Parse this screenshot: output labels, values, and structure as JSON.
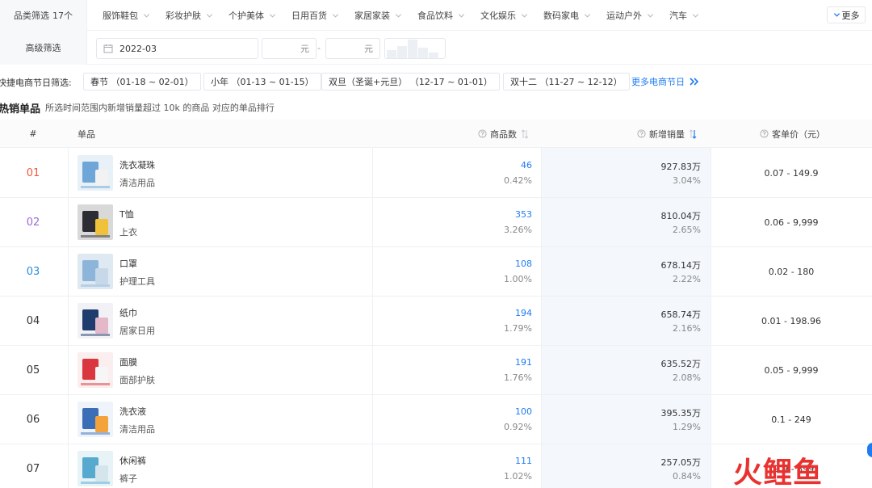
{
  "category_filter": {
    "label": "品类筛选",
    "count": "17个",
    "items": [
      "服饰鞋包",
      "彩妆护肤",
      "个护美体",
      "日用百货",
      "家居家装",
      "食品饮料",
      "文化娱乐",
      "数码家电",
      "运动户外",
      "汽车"
    ],
    "more_label": "更多"
  },
  "advanced_filter": {
    "label": "高级筛选",
    "date": "2022-03",
    "price_min_unit": "元",
    "price_max_unit": "元",
    "separator": "-"
  },
  "festival_filter": {
    "label": "快捷电商节日筛选:",
    "chips": [
      "春节 （01-18 ~ 02-01）",
      "小年 （01-13 ~ 01-15）",
      "双旦（圣诞+元旦） （12-17 ~ 01-01）",
      "双十二 （11-27 ~ 12-12）"
    ],
    "more_label": "更多电商节日"
  },
  "section": {
    "title": "热销单品",
    "desc": "所选时间范围内新增销量超过 10k 的商品 对应的单品排行"
  },
  "table": {
    "headers": {
      "rank": "#",
      "product": "单品",
      "count": "商品数",
      "sales": "新增销量",
      "price": "客单价（元）"
    },
    "rows": [
      {
        "rank": "01",
        "name": "洗衣凝珠",
        "category": "清洁用品",
        "count": "46",
        "count_pct": "0.42%",
        "sales": "927.83万",
        "sales_pct": "3.04%",
        "price": "0.07 - 149.9"
      },
      {
        "rank": "02",
        "name": "T恤",
        "category": "上衣",
        "count": "353",
        "count_pct": "3.26%",
        "sales": "810.04万",
        "sales_pct": "2.65%",
        "price": "0.06 - 9,999"
      },
      {
        "rank": "03",
        "name": "口罩",
        "category": "护理工具",
        "count": "108",
        "count_pct": "1.00%",
        "sales": "678.14万",
        "sales_pct": "2.22%",
        "price": "0.02 - 180"
      },
      {
        "rank": "04",
        "name": "纸巾",
        "category": "居家日用",
        "count": "194",
        "count_pct": "1.79%",
        "sales": "658.74万",
        "sales_pct": "2.16%",
        "price": "0.01 - 198.96"
      },
      {
        "rank": "05",
        "name": "面膜",
        "category": "面部护肤",
        "count": "191",
        "count_pct": "1.76%",
        "sales": "635.52万",
        "sales_pct": "2.08%",
        "price": "0.05 - 9,999"
      },
      {
        "rank": "06",
        "name": "洗衣液",
        "category": "清洁用品",
        "count": "100",
        "count_pct": "0.92%",
        "sales": "395.35万",
        "sales_pct": "1.29%",
        "price": "0.1 - 249"
      },
      {
        "rank": "07",
        "name": "休闲裤",
        "category": "裤子",
        "count": "111",
        "count_pct": "1.02%",
        "sales": "257.05万",
        "sales_pct": "0.84%",
        "price": "19.9 - 399"
      }
    ]
  },
  "rank_colors": [
    "#f05a3c",
    "#9b6ad6",
    "#2a8bdc",
    "#333333",
    "#333333",
    "#333333",
    "#333333"
  ],
  "watermark": "火鲤鱼",
  "accent_color": "#1e7bf2"
}
